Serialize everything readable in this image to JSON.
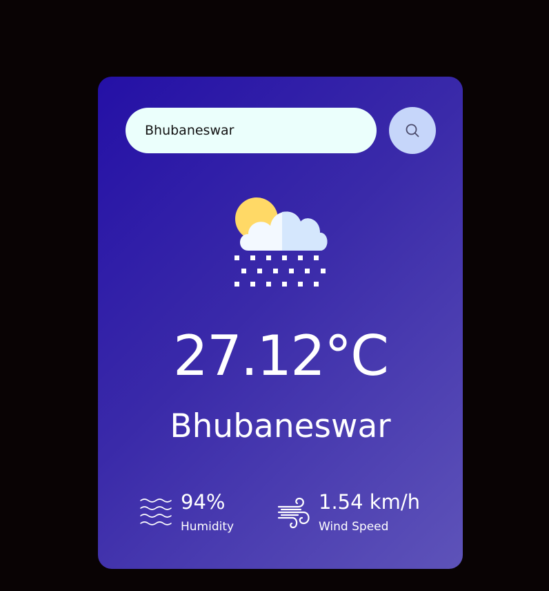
{
  "search": {
    "value": "Bhubaneswar",
    "button_icon": "search-icon"
  },
  "weather": {
    "icon": "sun-cloud-snow-icon",
    "temperature": "27.12°C",
    "city": "Bhubaneswar"
  },
  "details": {
    "humidity": {
      "value": "94%",
      "label": "Humidity",
      "icon": "humidity-waves-icon"
    },
    "wind": {
      "value": "1.54 km/h",
      "label": "Wind Speed",
      "icon": "wind-icon"
    }
  },
  "colors": {
    "page_background": "#090304",
    "card_gradient_start": "#2410a6",
    "card_gradient_end": "#5e53b9",
    "search_input_bg": "#ebfffc",
    "search_button_bg": "#c6d6fa",
    "text": "#ffffff"
  }
}
